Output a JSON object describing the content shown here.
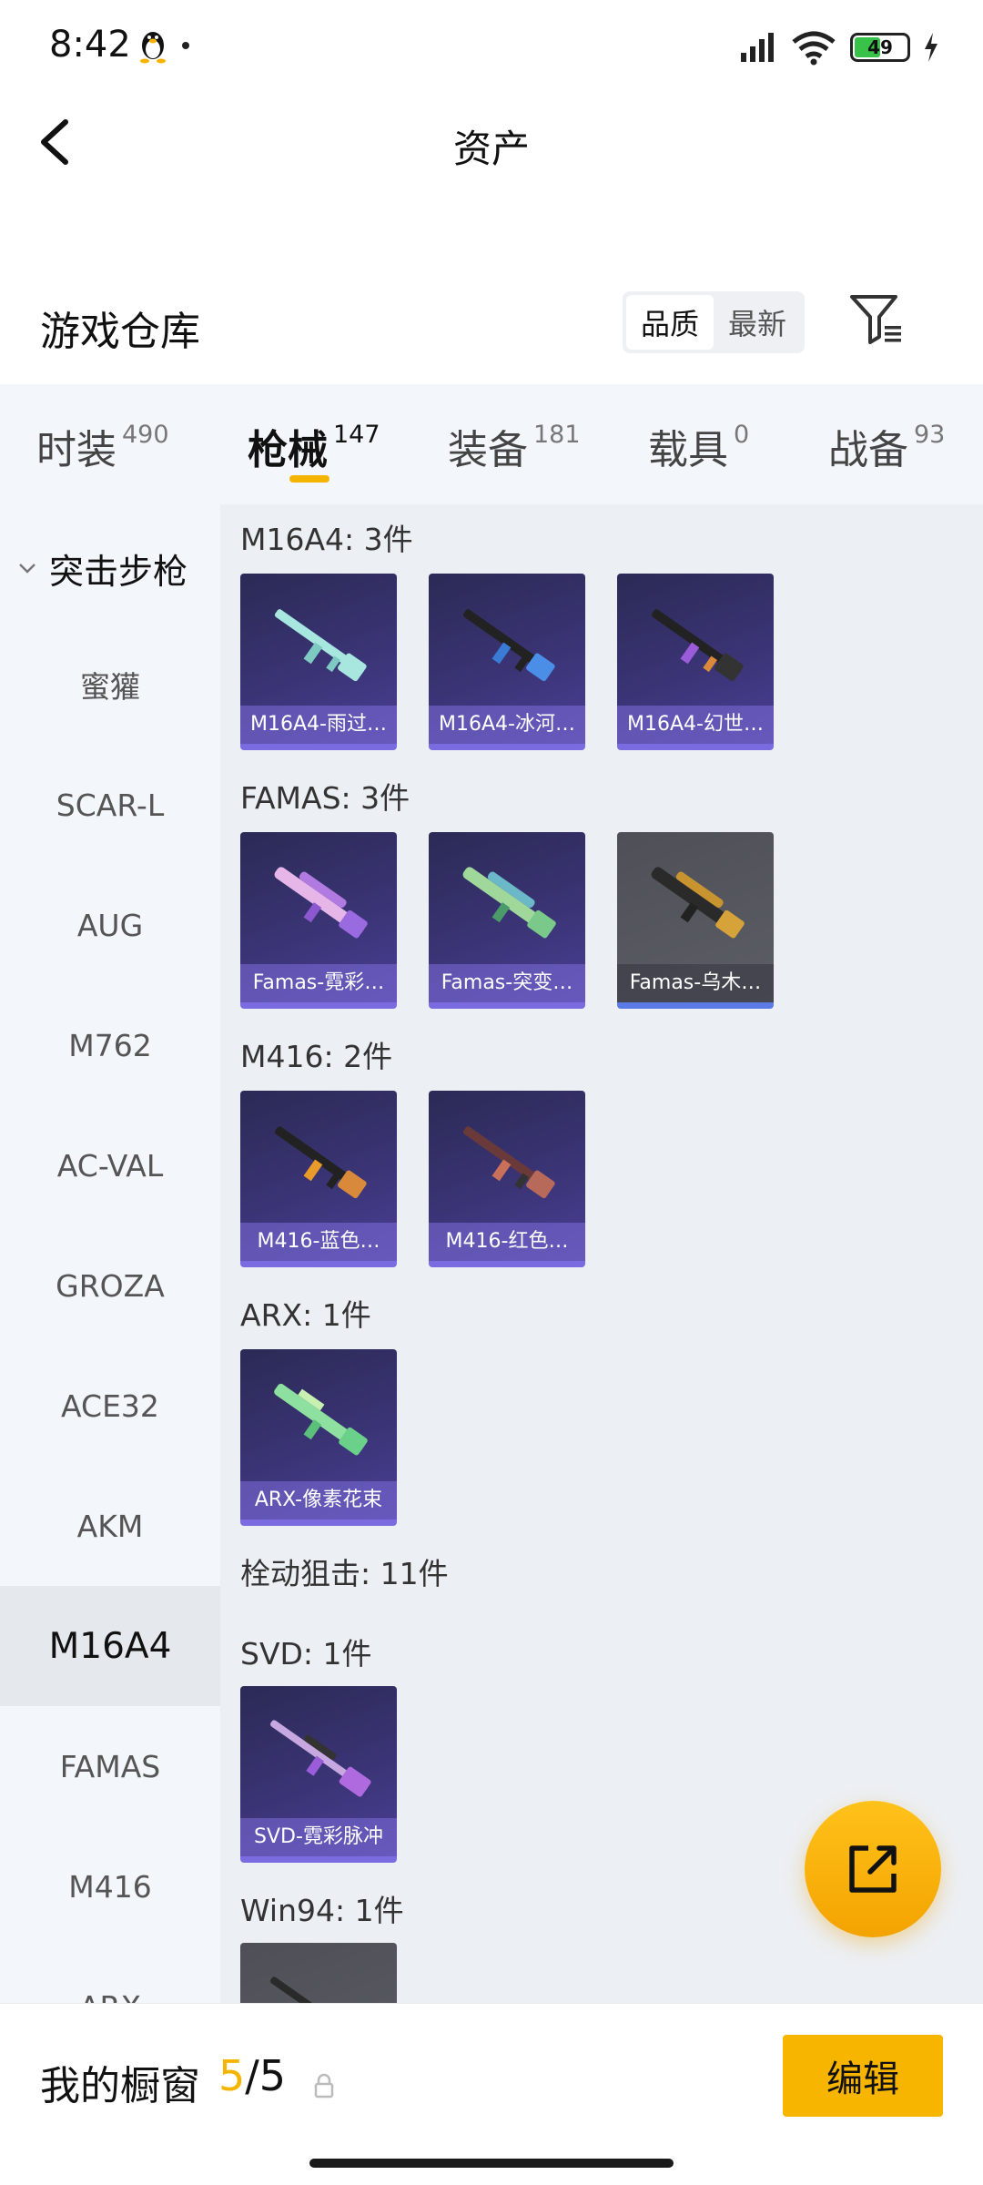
{
  "status": {
    "time": "8:42",
    "battery": "49"
  },
  "header": {
    "title": "资产"
  },
  "section": {
    "title": "游戏仓库",
    "sort_options": [
      "品质",
      "最新"
    ]
  },
  "tabs": [
    {
      "label": "时装",
      "count": "490"
    },
    {
      "label": "枪械",
      "count": "147"
    },
    {
      "label": "装备",
      "count": "181"
    },
    {
      "label": "载具",
      "count": "0"
    },
    {
      "label": "战备",
      "count": "93"
    }
  ],
  "sidebar": {
    "group": "突击步枪",
    "items": [
      "蜜獾",
      "SCAR-L",
      "AUG",
      "M762",
      "AC-VAL",
      "GROZA",
      "ACE32",
      "AKM",
      "M16A4",
      "FAMAS",
      "M416",
      "ARX"
    ]
  },
  "groups": [
    {
      "title": "M16A4: 3件",
      "items": [
        "M16A4-雨过…",
        "M16A4-冰河…",
        "M16A4-幻世…"
      ]
    },
    {
      "title": "FAMAS: 3件",
      "items": [
        "Famas-霓彩…",
        "Famas-突变…",
        "Famas-乌木…"
      ]
    },
    {
      "title": "M416: 2件",
      "items": [
        "M416-蓝色…",
        "M416-红色…"
      ]
    },
    {
      "title": "ARX: 1件",
      "items": [
        "ARX-像素花束"
      ]
    },
    {
      "title": "栓动狙击: 11件",
      "items": []
    },
    {
      "title": "SVD: 1件",
      "items": [
        "SVD-霓彩脉冲"
      ]
    },
    {
      "title": "Win94: 1件",
      "items": []
    }
  ],
  "bottom": {
    "label": "我的橱窗",
    "current": "5",
    "total": "/5",
    "edit": "编辑"
  },
  "colors": {
    "accent": "#f5b400",
    "card_purple": "#3a3475",
    "card_gray": "#5a5c64"
  }
}
